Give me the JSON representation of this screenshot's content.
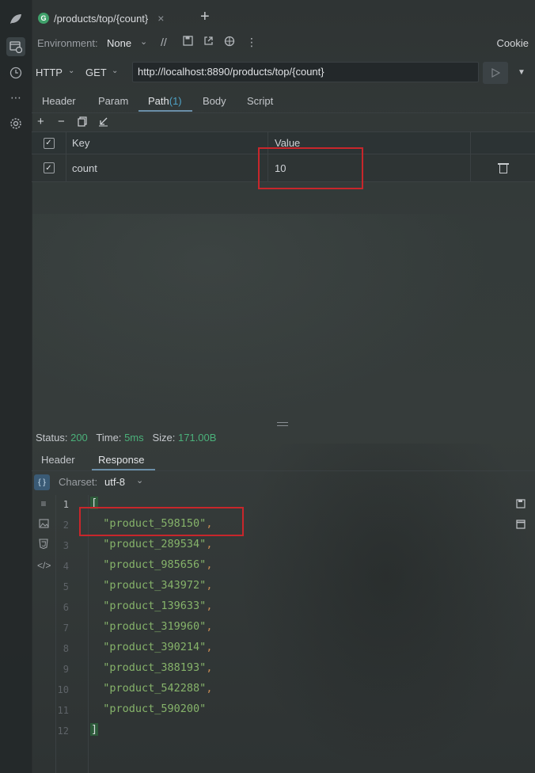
{
  "tab": {
    "icon_letter": "G",
    "title": "/products/top/{count}",
    "close": "×",
    "add": "+"
  },
  "environment": {
    "label": "Environment:",
    "value": "None",
    "cookie_label": "Cookie"
  },
  "request": {
    "protocol": "HTTP",
    "method": "GET",
    "url": "http://localhost:8890/products/top/{count}"
  },
  "request_tabs": [
    {
      "label": "Header"
    },
    {
      "label": "Param"
    },
    {
      "label": "Path",
      "count": "(1)"
    },
    {
      "label": "Body"
    },
    {
      "label": "Script"
    }
  ],
  "param_tools": {
    "add": "+",
    "remove": "−"
  },
  "params_table": {
    "headers": {
      "key": "Key",
      "value": "Value"
    },
    "rows": [
      {
        "key": "count",
        "value": "10",
        "checked": "✓"
      }
    ],
    "header_checked": "✓"
  },
  "status": {
    "status_label": "Status:",
    "status_value": "200",
    "time_label": "Time:",
    "time_value": "5ms",
    "size_label": "Size:",
    "size_value": "171.00B"
  },
  "response_tabs": [
    {
      "label": "Header"
    },
    {
      "label": "Response"
    }
  ],
  "charset": {
    "label": "Charset:",
    "value": "utf-8"
  },
  "response_body": {
    "open": "[",
    "close": "]",
    "items": [
      "\"product_598150\"",
      "\"product_289534\"",
      "\"product_985656\"",
      "\"product_343972\"",
      "\"product_139633\"",
      "\"product_319960\"",
      "\"product_390214\"",
      "\"product_388193\"",
      "\"product_542288\"",
      "\"product_590200\""
    ],
    "line_numbers": [
      "1",
      "2",
      "3",
      "4",
      "5",
      "6",
      "7",
      "8",
      "9",
      "10",
      "11",
      "12"
    ]
  },
  "colors": {
    "status_ok": "#4bb17a",
    "highlight_box": "#c8262b",
    "json_string": "#86b36a",
    "accent_tab": "#6b8fa8"
  },
  "icons": [
    "leaf-icon",
    "http-client-icon",
    "history-icon",
    "more-icon",
    "settings-icon",
    "play-icon",
    "trash-icon",
    "save-icon",
    "format-icon"
  ]
}
